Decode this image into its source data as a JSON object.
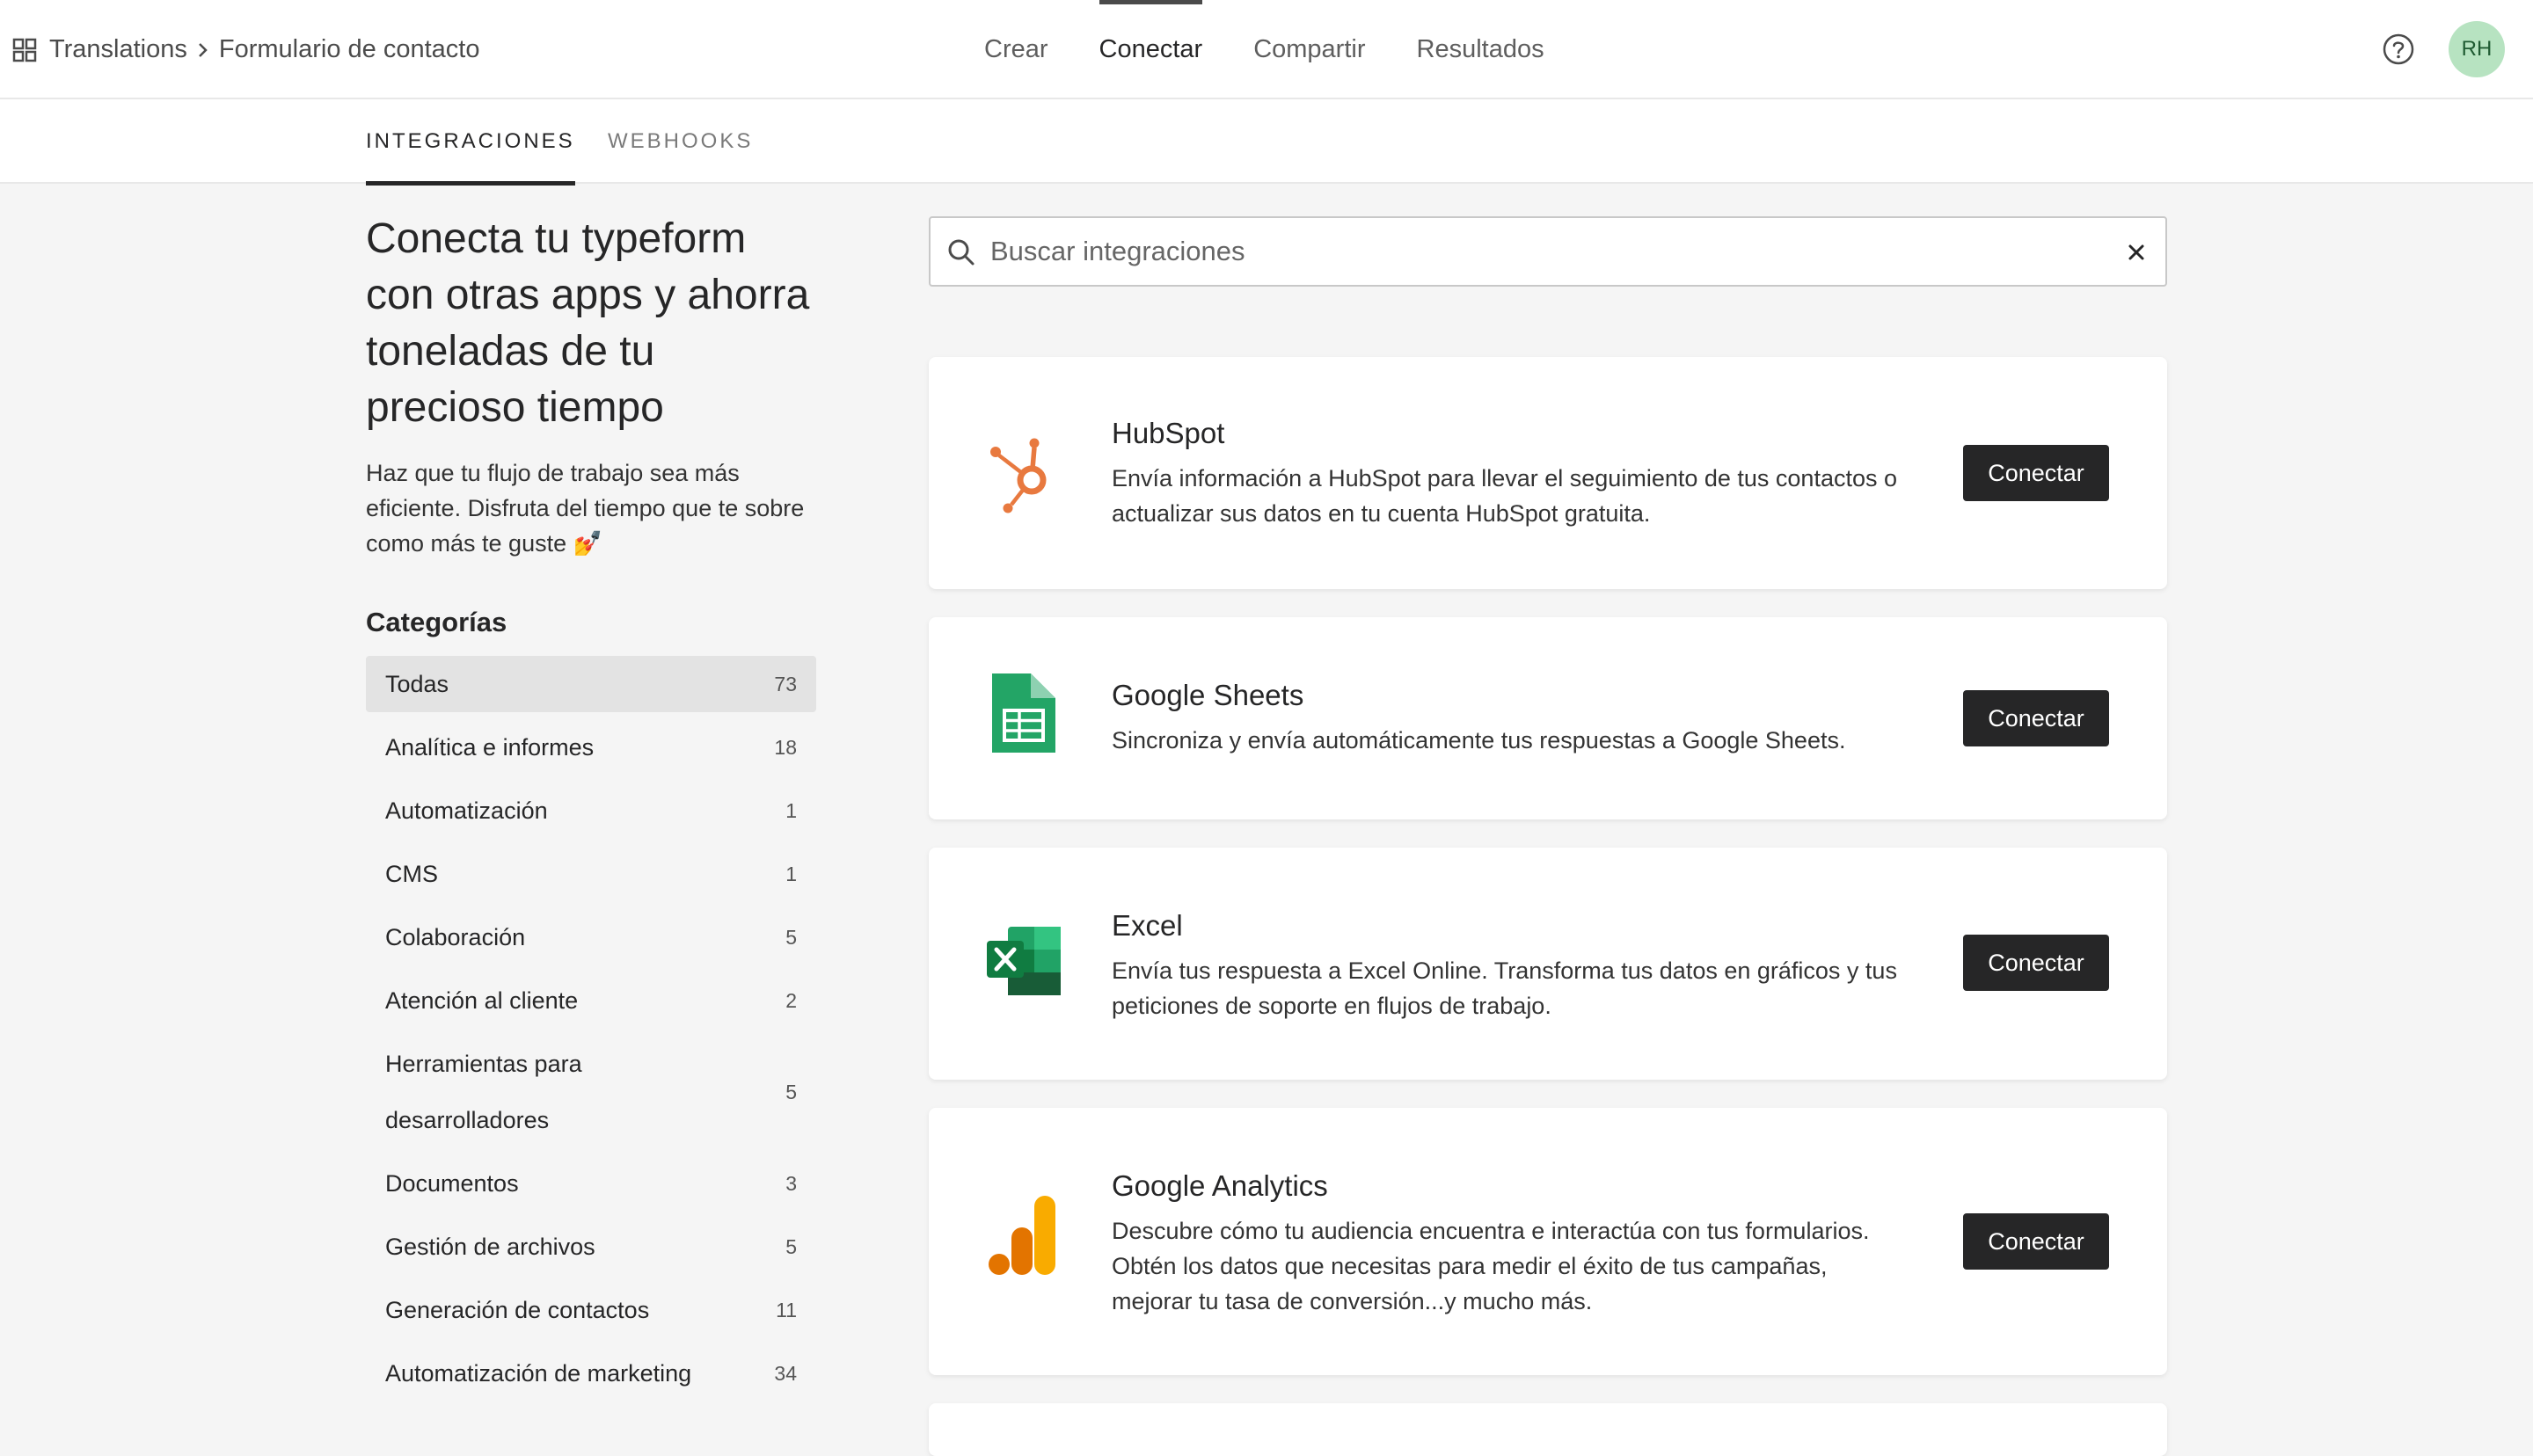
{
  "header": {
    "breadcrumb": [
      "Translations",
      "Formulario de contacto"
    ],
    "nav": [
      "Crear",
      "Conectar",
      "Compartir",
      "Resultados"
    ],
    "active_nav": "Conectar",
    "avatar_initials": "RH"
  },
  "subtabs": [
    "INTEGRACIONES",
    "WEBHOOKS"
  ],
  "left": {
    "headline": "Conecta tu typeform con otras apps y ahorra toneladas de tu precioso tiempo",
    "intro": "Haz que tu flujo de trabajo sea más eficiente. Disfruta del tiempo que te sobre como más te guste 💅",
    "categories_title": "Categorías",
    "categories": [
      {
        "label": "Todas",
        "count": "73"
      },
      {
        "label": "Analítica e informes",
        "count": "18"
      },
      {
        "label": "Automatización",
        "count": "1"
      },
      {
        "label": "CMS",
        "count": "1"
      },
      {
        "label": "Colaboración",
        "count": "5"
      },
      {
        "label": "Atención al cliente",
        "count": "2"
      },
      {
        "label": "Herramientas para desarrolladores",
        "count": "5"
      },
      {
        "label": "Documentos",
        "count": "3"
      },
      {
        "label": "Gestión de archivos",
        "count": "5"
      },
      {
        "label": "Generación de contactos",
        "count": "11"
      },
      {
        "label": "Automatización de marketing",
        "count": "34"
      }
    ]
  },
  "search": {
    "placeholder": "Buscar integraciones",
    "value": ""
  },
  "integrations": [
    {
      "name": "HubSpot",
      "description": "Envía información a HubSpot para llevar el seguimiento de tus contactos o actualizar sus datos en tu cuenta HubSpot gratuita.",
      "button": "Conectar",
      "icon": "hubspot-icon"
    },
    {
      "name": "Google Sheets",
      "description": "Sincroniza y envía automáticamente tus respuestas a Google Sheets.",
      "button": "Conectar",
      "icon": "google-sheets-icon"
    },
    {
      "name": "Excel",
      "description": "Envía tus respuesta a Excel Online. Transforma tus datos en gráficos y tus peticiones de soporte en flujos de trabajo.",
      "button": "Conectar",
      "icon": "excel-icon"
    },
    {
      "name": "Google Analytics",
      "description": "Descubre cómo tu audiencia encuentra e interactúa con tus formularios. Obtén los datos que necesitas para medir el éxito de tus campañas, mejorar tu tasa de conversión...y mucho más.",
      "button": "Conectar",
      "icon": "google-analytics-icon"
    }
  ],
  "colors": {
    "hubspot": "#e8793f",
    "sheets": "#23a566",
    "excel": "#1f7244",
    "analytics_dark": "#e37400",
    "analytics_light": "#f9ab00",
    "button": "#262627",
    "avatar_bg": "#b7e3c1"
  }
}
